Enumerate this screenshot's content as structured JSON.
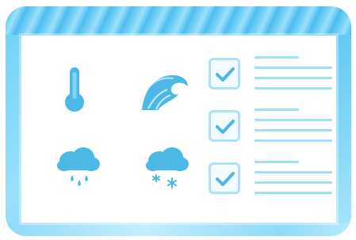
{
  "window": {
    "accent": "#6fd0f7",
    "icon_color": "#4cb8e6"
  },
  "weather_icons": [
    "thermometer-icon",
    "wave-icon",
    "rain-cloud-icon",
    "snow-cloud-icon"
  ],
  "checklist": {
    "items": [
      {
        "checked": true
      },
      {
        "checked": true
      },
      {
        "checked": true
      }
    ]
  }
}
